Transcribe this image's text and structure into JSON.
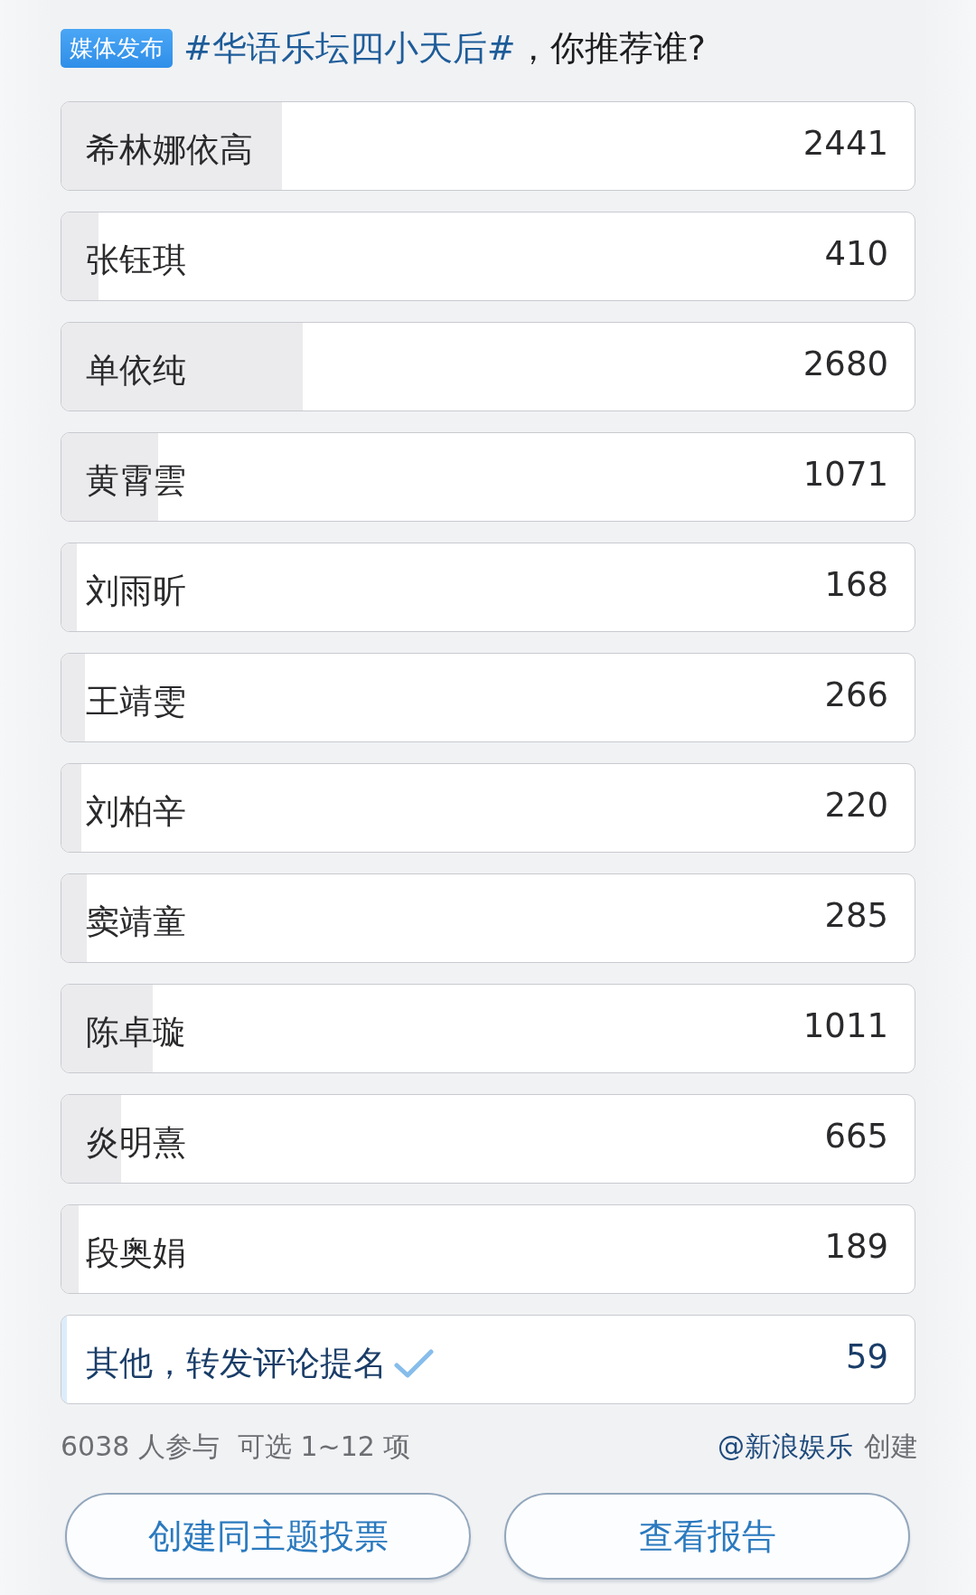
{
  "poll": {
    "badge": "媒体发布",
    "topic": "#华语乐坛四小天后#",
    "question": "，你推荐谁?"
  },
  "options": [
    {
      "label": "希林娜依高",
      "votes": "2441",
      "level": 0.258,
      "selected": false
    },
    {
      "label": "张钰琪",
      "votes": "410",
      "level": 0.043,
      "selected": false
    },
    {
      "label": "单依纯",
      "votes": "2680",
      "level": 0.283,
      "selected": false
    },
    {
      "label": "黄霄雲",
      "votes": "1071",
      "level": 0.113,
      "selected": false
    },
    {
      "label": "刘雨昕",
      "votes": "168",
      "level": 0.018,
      "selected": false
    },
    {
      "label": "王靖雯",
      "votes": "266",
      "level": 0.028,
      "selected": false
    },
    {
      "label": "刘柏辛",
      "votes": "220",
      "level": 0.023,
      "selected": false
    },
    {
      "label": "窦靖童",
      "votes": "285",
      "level": 0.03,
      "selected": false
    },
    {
      "label": "陈卓璇",
      "votes": "1011",
      "level": 0.107,
      "selected": false
    },
    {
      "label": "炎明熹",
      "votes": "665",
      "level": 0.07,
      "selected": false
    },
    {
      "label": "段奥娟",
      "votes": "189",
      "level": 0.02,
      "selected": false
    },
    {
      "label": "其他，转发评论提名",
      "votes": "59",
      "level": 0.006,
      "selected": true
    }
  ],
  "footer": {
    "participants": "6038 人参与",
    "limit": "可选 1~12 项",
    "creator": "@新浪娱乐",
    "created": "创建"
  },
  "buttons": [
    "创建同主题投票",
    "查看报告"
  ]
}
